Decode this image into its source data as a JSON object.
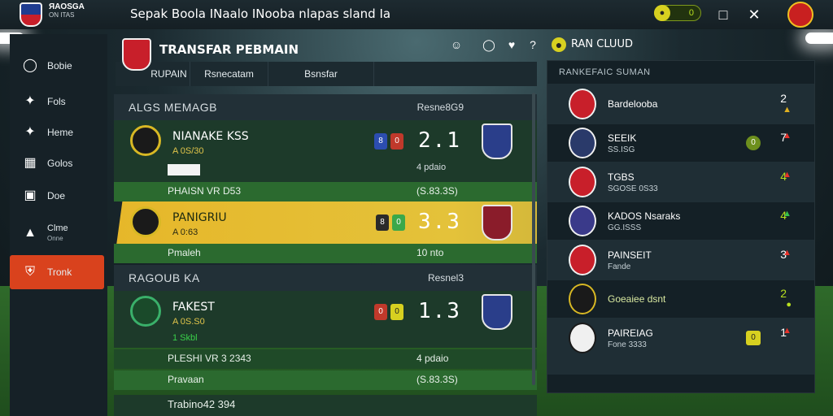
{
  "topbar": {
    "logo_text": "ЯAOSGA",
    "logo_sub": "ON ITAS",
    "title": "Sepak Boola INaalo INooba nlapas sland Ia",
    "pill_value": "0",
    "icons": [
      "coin-icon",
      "bell-icon",
      "close-icon",
      "avatar-icon"
    ]
  },
  "sidebar": {
    "items": [
      {
        "label": "Bobie",
        "icon": "ball-icon"
      },
      {
        "label": "Fols",
        "icon": "bird-icon"
      },
      {
        "label": "Heme",
        "icon": "bird-icon"
      },
      {
        "label": "Golos",
        "icon": "calendar-icon"
      },
      {
        "label": "Doe",
        "icon": "chat-icon"
      },
      {
        "label": "Clme",
        "sub": "Onne",
        "icon": "tshirt-icon"
      },
      {
        "label": "Tronk",
        "icon": "shield-icon"
      }
    ]
  },
  "transfer": {
    "title": "TRANSFAR PEBMAIN",
    "tabs": [
      "RUPAIN",
      "Rsnecatam",
      "Bsnsfar"
    ]
  },
  "groups": [
    {
      "title": "ALGS MEMAGB",
      "right": "Resne8G9",
      "matches": [
        {
          "name": "NIANAKE KSS",
          "sub": "A 0S/30",
          "score": "2.1",
          "note": "4 pdaio",
          "strip_left": "PHAISN VR D53",
          "strip_right": "(S.83.3S)"
        },
        {
          "name": "PANIGRIU",
          "sub": "A 0:63",
          "score": "3.3",
          "note": "10 nto",
          "strip_left": "Pmaleh",
          "strip_right": ""
        }
      ]
    },
    {
      "title": "RAGOUB KA",
      "right": "Resnel3",
      "matches": [
        {
          "name": "FAKEST",
          "sub": "A 0S.S0",
          "score": "1.3",
          "note": "4 pdaio",
          "strip_left": "PLESHI VR 3 2343",
          "strip_right": "(S.83.3S)",
          "extra": "1 Skbl",
          "strip2": "Pravaan"
        }
      ]
    }
  ],
  "footer_row": "Trabino42 394",
  "ranking": {
    "title": "RAN CLUUD",
    "subtitle": "RANKEFAIC SUMAN",
    "rows": [
      {
        "name": "Bardelooba",
        "sub": "",
        "num": "2",
        "trend": "up"
      },
      {
        "name": "SEEIK",
        "sub": "SS.ISG",
        "num": "7",
        "trend": "up"
      },
      {
        "name": "TGBS",
        "sub": "SGOSE 0S33",
        "num": "4",
        "trend": "up"
      },
      {
        "name": "KADOS Nsaraks",
        "sub": "GG.ISSS",
        "num": "4",
        "trend": "up"
      },
      {
        "name": "PAINSEIT",
        "sub": "Fande",
        "num": "3",
        "trend": "down"
      },
      {
        "name": "Goeaiee dsnt",
        "sub": "",
        "num": "2",
        "trend": "down"
      },
      {
        "name": "PAIREIAG",
        "sub": "Fone 3333",
        "num": "1",
        "trend": "up"
      }
    ]
  },
  "colors": {
    "accent": "#d9421d",
    "highlight": "#e6b72a",
    "pitch": "#1d3a2a",
    "up": "#34c24a",
    "down": "#e8322a"
  }
}
